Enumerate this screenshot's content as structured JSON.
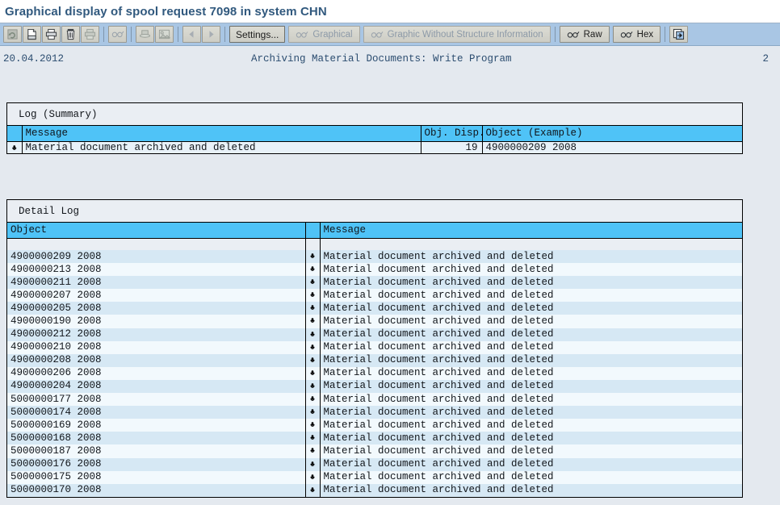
{
  "window": {
    "title": "Graphical display of spool request 7098 in system CHN"
  },
  "toolbar": {
    "icon_buttons": [
      {
        "name": "refresh-icon",
        "enabled": false
      },
      {
        "name": "save-document-icon",
        "enabled": true
      },
      {
        "name": "print-icon",
        "enabled": true
      },
      {
        "name": "delete-trash-icon",
        "enabled": true
      },
      {
        "name": "print-preview-icon",
        "enabled": false
      },
      {
        "name": "glasses-display-icon",
        "enabled": false
      },
      {
        "name": "hat-icon",
        "enabled": false
      },
      {
        "name": "picture-icon",
        "enabled": false
      },
      {
        "name": "previous-page-icon",
        "enabled": false
      },
      {
        "name": "next-page-icon",
        "enabled": false
      }
    ],
    "settings_label": "Settings...",
    "graphical_label": "Graphical",
    "graphic_without_structure_label": "Graphic Without Structure Information",
    "raw_label": "Raw",
    "hex_label": "Hex",
    "export_icon": "export-icon"
  },
  "report_header": {
    "date": "20.04.2012",
    "title": "Archiving Material Documents: Write Program",
    "page": "2"
  },
  "summary_panel": {
    "title": "Log (Summary)",
    "columns": [
      "Message",
      "Obj. Disp.",
      "Object (Example)"
    ],
    "rows": [
      {
        "bullet": "♣",
        "message": "Material document archived and deleted",
        "obj_disp": "19",
        "object_example": "4900000209 2008"
      }
    ]
  },
  "detail_panel": {
    "title": "Detail Log",
    "columns": [
      "Object",
      "",
      "Message"
    ],
    "rows": [
      {
        "object": "4900000209 2008",
        "bullet": "♣",
        "message": "Material document archived and deleted"
      },
      {
        "object": "4900000213 2008",
        "bullet": "♣",
        "message": "Material document archived and deleted"
      },
      {
        "object": "4900000211 2008",
        "bullet": "♣",
        "message": "Material document archived and deleted"
      },
      {
        "object": "4900000207 2008",
        "bullet": "♣",
        "message": "Material document archived and deleted"
      },
      {
        "object": "4900000205 2008",
        "bullet": "♣",
        "message": "Material document archived and deleted"
      },
      {
        "object": "4900000190 2008",
        "bullet": "♣",
        "message": "Material document archived and deleted"
      },
      {
        "object": "4900000212 2008",
        "bullet": "♣",
        "message": "Material document archived and deleted"
      },
      {
        "object": "4900000210 2008",
        "bullet": "♣",
        "message": "Material document archived and deleted"
      },
      {
        "object": "4900000208 2008",
        "bullet": "♣",
        "message": "Material document archived and deleted"
      },
      {
        "object": "4900000206 2008",
        "bullet": "♣",
        "message": "Material document archived and deleted"
      },
      {
        "object": "4900000204 2008",
        "bullet": "♣",
        "message": "Material document archived and deleted"
      },
      {
        "object": "5000000177 2008",
        "bullet": "♣",
        "message": "Material document archived and deleted"
      },
      {
        "object": "5000000174 2008",
        "bullet": "♣",
        "message": "Material document archived and deleted"
      },
      {
        "object": "5000000169 2008",
        "bullet": "♣",
        "message": "Material document archived and deleted"
      },
      {
        "object": "5000000168 2008",
        "bullet": "♣",
        "message": "Material document archived and deleted"
      },
      {
        "object": "5000000187 2008",
        "bullet": "♣",
        "message": "Material document archived and deleted"
      },
      {
        "object": "5000000176 2008",
        "bullet": "♣",
        "message": "Material document archived and deleted"
      },
      {
        "object": "5000000175 2008",
        "bullet": "♣",
        "message": "Material document archived and deleted"
      },
      {
        "object": "5000000170 2008",
        "bullet": "♣",
        "message": "Material document archived and deleted"
      }
    ]
  },
  "colors": {
    "title_text": "#31597e",
    "toolbar_bg": "#a9c6e4",
    "page_bg": "#e4e9ef",
    "header_cyan": "#4fc3f7",
    "row_odd": "#d6e8f4",
    "row_even": "#f2f9fd",
    "mono_text": "#2c4d70"
  }
}
